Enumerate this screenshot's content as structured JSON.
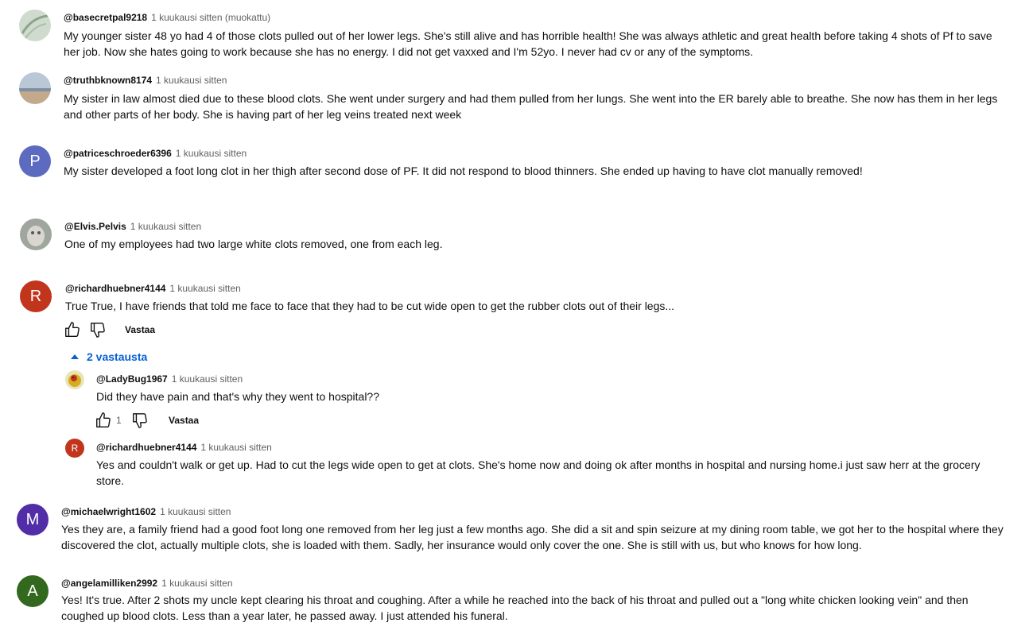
{
  "comments": [
    {
      "author": "@basecretpal9218",
      "time": "1 kuukausi sitten (muokattu)",
      "line1": "My younger sister 48 yo had 4 of those clots pulled out of her lower legs. She's still alive and has horrible health! She was always athletic and great health before taking 4 shots of Pf to save",
      "line2": "her job. Now she hates going to work because she has no energy. I did not get vaxxed and I'm 52yo. I never had cv or any of the symptoms."
    },
    {
      "author": "@truthbknown8174",
      "time": "1 kuukausi sitten",
      "line1": "My sister in law almost died due to these blood clots. She went under surgery and had them pulled from her lungs. She went into the ER barely able to breathe. She now has them in her legs",
      "line2": "and other parts of her body. She is having part of her leg veins treated next week"
    },
    {
      "author": "@patriceschroeder6396",
      "time": "1 kuukausi sitten",
      "initial": "P",
      "line1": "My sister developed a foot long clot in her thigh after second dose of PF. It did not respond to blood thinners. She ended up having to have clot manually removed!"
    },
    {
      "author": "@Elvis.Pelvis",
      "time": "1 kuukausi sitten",
      "line1": "One of my employees had two large white clots removed, one from each leg."
    },
    {
      "author": "@richardhuebner4144",
      "time": "1 kuukausi sitten",
      "initial": "R",
      "line1": "True True, I have friends that told me face to face that they had to be cut wide open to get the rubber clots out of their legs...",
      "reply_label": "Vastaa",
      "replies_toggle": "2 vastausta"
    },
    {
      "author": "@michaelwright1602",
      "time": "1 kuukausi sitten",
      "initial": "M",
      "line1": "Yes they are, a family friend had a good foot long one removed from her leg just a few months ago. She did a sit and spin seizure at my dining room table, we got her to the hospital where they",
      "line2": "discovered the clot, actually multiple clots, she is loaded with them. Sadly, her insurance would only cover the one. She is still with us, but who knows for how long."
    },
    {
      "author": "@angelamilliken2992",
      "time": "1 kuukausi sitten",
      "initial": "A",
      "line1": "Yes! It's true. After 2 shots my uncle kept clearing his throat and coughing. After a while he reached into the back of his throat and pulled out a \"long white chicken looking vein\" and then",
      "line2": "coughed up blood clots. Less than a year later, he passed away. I just attended his funeral."
    }
  ],
  "replies": [
    {
      "author": "@LadyBug1967",
      "time": "1 kuukausi sitten",
      "line1": "Did they have pain and that's why they went to hospital??",
      "likes": "1",
      "reply_label": "Vastaa"
    },
    {
      "author": "@richardhuebner4144",
      "time": "1 kuukausi sitten",
      "initial": "R",
      "line1": "Yes and couldn't walk or get up. Had to cut the legs wide open to get at clots. She's home now and doing ok after months in hospital and nursing home.i just saw herr at the grocery",
      "line2": "store."
    }
  ],
  "colors": {
    "avatar_p": "#5c6bc0",
    "avatar_r": "#c1351d",
    "avatar_m": "#512da8",
    "avatar_a": "#33691e",
    "link_blue": "#065fd4"
  }
}
